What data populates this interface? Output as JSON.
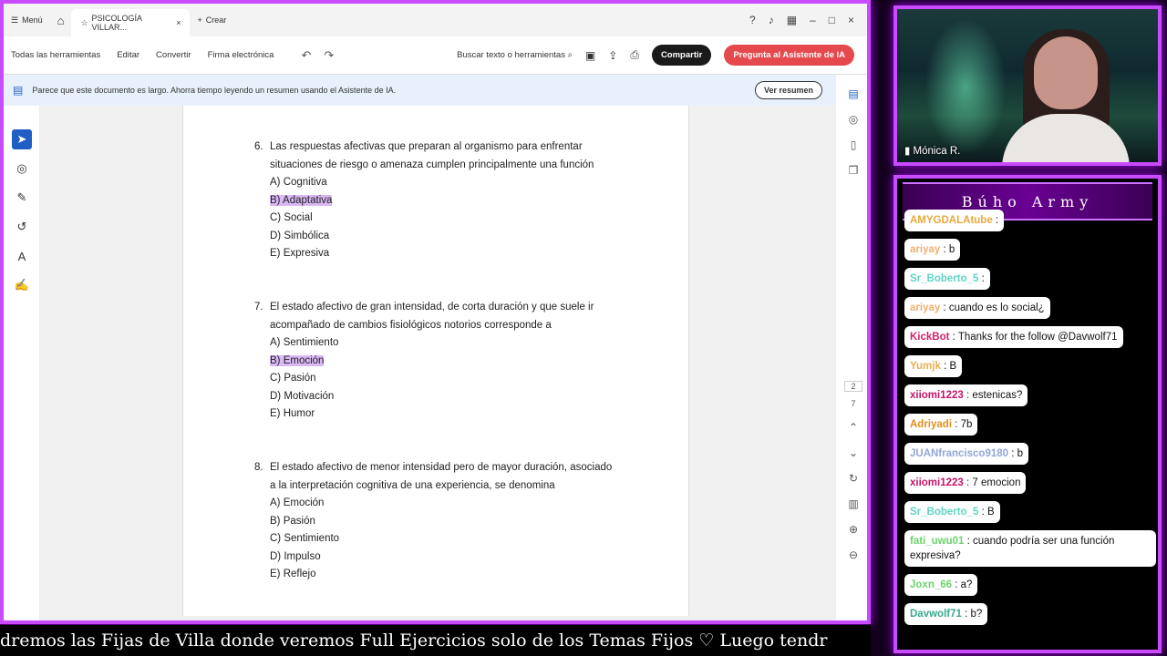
{
  "browser": {
    "menu_label": "Menú",
    "tab_title": "PSICOLOGÍA VILLAR...",
    "new_tab": "Crear"
  },
  "toolbar": {
    "items": [
      "Todas las herramientas",
      "Editar",
      "Convertir",
      "Firma electrónica"
    ],
    "search_label": "Buscar texto o herramientas",
    "share_label": "Compartir",
    "ai_label": "Pregunta al Asistente de IA"
  },
  "notice": {
    "text": "Parece que este documento es largo. Ahorra tiempo leyendo un resumen usando el Asistente de IA.",
    "button": "Ver resumen"
  },
  "pages": {
    "current": "2",
    "total": "7"
  },
  "questions": [
    {
      "num": "6.",
      "stem": "Las respuestas afectivas que preparan al organismo para enfrentar situaciones de riesgo o amenaza cumplen principalmente una función",
      "options": [
        "A)  Cognitiva",
        "B)  Adaptativa",
        "C)  Social",
        "D)  Simbólica",
        "E)  Expresiva"
      ]
    },
    {
      "num": "7.",
      "stem": "El estado afectivo de gran intensidad, de corta duración y que suele ir acompañado de cambios fisiológicos notorios corresponde a",
      "options": [
        "A)  Sentimiento",
        "B)  Emoción",
        "C)  Pasión",
        "D)  Motivación",
        "E)  Humor"
      ]
    },
    {
      "num": "8.",
      "stem": "El estado afectivo de menor intensidad pero de mayor duración, asociado a la interpretación cognitiva de una experiencia, se denomina",
      "options": [
        "A)  Emoción",
        "B)  Pasión",
        "C)  Sentimiento",
        "D)  Impulso",
        "E)  Reflejo"
      ]
    }
  ],
  "cam": {
    "name": "Mónica R."
  },
  "chat": {
    "title": "Búho Army",
    "messages": [
      {
        "user": "AMYGDALAtube",
        "text": ":",
        "color": "#e8a93c"
      },
      {
        "user": "ariyay",
        "text": ": b",
        "color": "#f0b070"
      },
      {
        "user": "Sr_Boberto_5",
        "text": ":",
        "color": "#5fd3c2"
      },
      {
        "user": "ariyay",
        "text": ": cuando es lo social¿",
        "color": "#f0b070"
      },
      {
        "user": "KickBot",
        "text": ": Thanks for the follow @Davwolf71",
        "color": "#d0216b"
      },
      {
        "user": "Yumjk",
        "text": ": B",
        "color": "#e8b050"
      },
      {
        "user": "xiiomi1223",
        "text": ": estenicas?",
        "color": "#c4146a"
      },
      {
        "user": "Adriyadi",
        "text": ": 7b",
        "color": "#e0901a"
      },
      {
        "user": "JUANfrancisco9180",
        "text": ": b",
        "color": "#8fa6d8"
      },
      {
        "user": "xiiomi1223",
        "text": ": 7 emocion",
        "color": "#c4146a"
      },
      {
        "user": "Sr_Boberto_5",
        "text": ": B",
        "color": "#5fd3c2"
      },
      {
        "user": "fati_uwu01",
        "text": ": cuando podría ser una función expresiva?",
        "color": "#6bd36b"
      },
      {
        "user": "Joxn_66",
        "text": ": a?",
        "color": "#6bd36b"
      },
      {
        "user": "Davwolf71",
        "text": ": b?",
        "color": "#3aa88f"
      }
    ]
  },
  "ticker": {
    "text": "dremos las Fijas de Villa donde veremos Full Ejercicios solo de los Temas Fijos    ♡    Luego tendr"
  }
}
